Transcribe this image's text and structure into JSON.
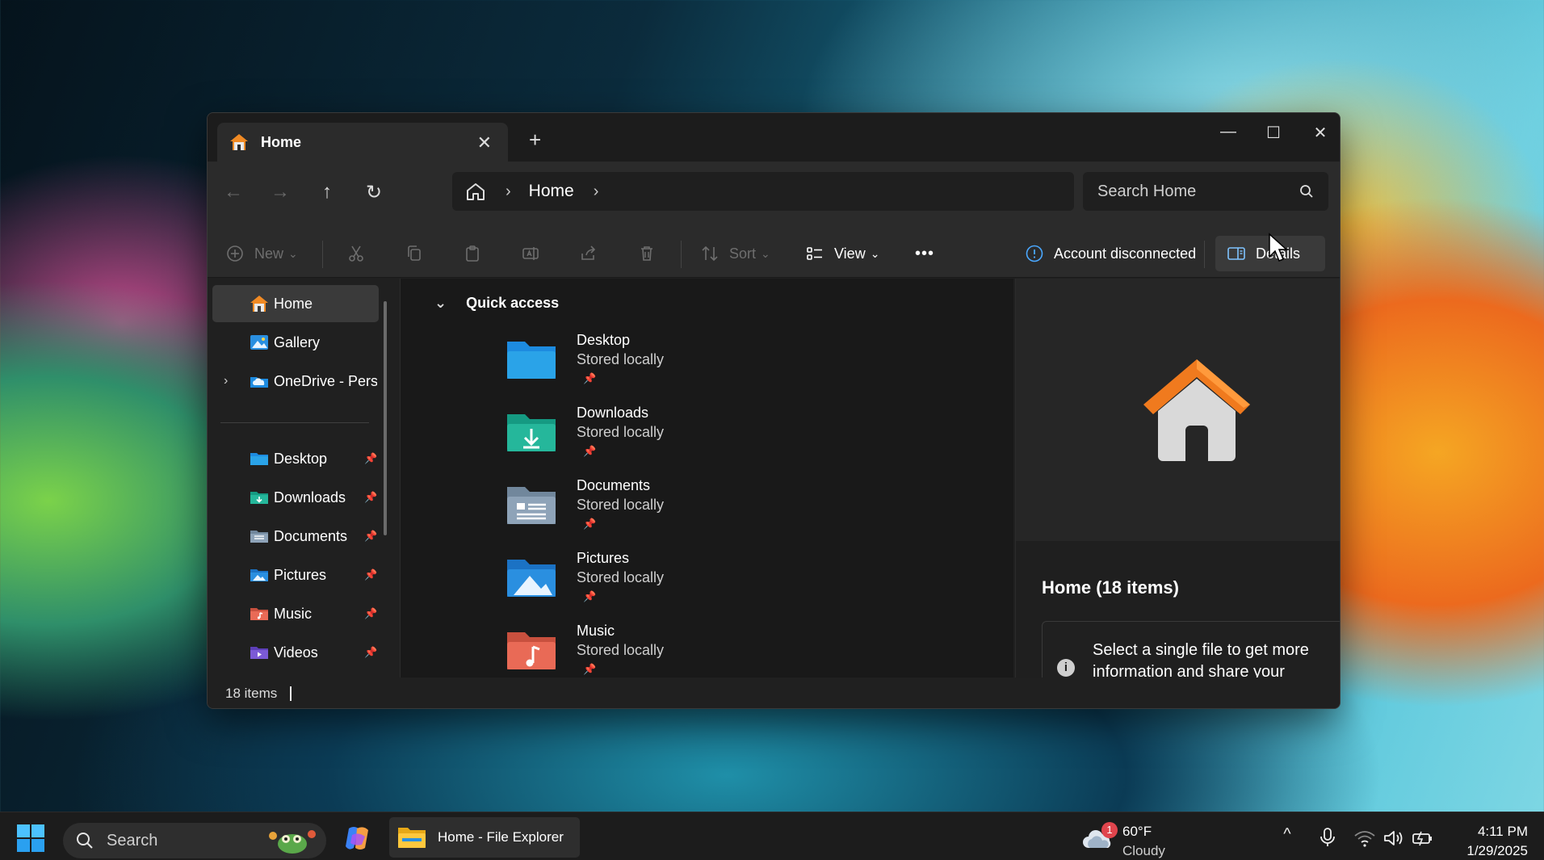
{
  "window": {
    "tab_title": "Home",
    "tab_close": "✕",
    "new_tab": "+",
    "minimize": "—",
    "maximize": "☐",
    "close": "✕"
  },
  "navbar": {
    "back": "←",
    "forward": "→",
    "up": "↑",
    "refresh": "↻",
    "breadcrumb": [
      "Home"
    ],
    "chevron": "›",
    "search_placeholder": "Search Home"
  },
  "toolbar": {
    "new_label": "New",
    "sort_label": "Sort",
    "view_label": "View",
    "more_label": "•••",
    "account_status": "Account disconnected",
    "details_label": "Details",
    "dropdown_caret": "⌄"
  },
  "sidebar": {
    "items": [
      {
        "label": "Home",
        "icon": "home-icon",
        "active": true
      },
      {
        "label": "Gallery",
        "icon": "gallery-icon"
      },
      {
        "label": "OneDrive - Personal",
        "icon": "onedrive-icon",
        "expandable": true
      }
    ],
    "pinned": [
      {
        "label": "Desktop",
        "icon": "desktop-folder-icon",
        "color": "#2aa3e8"
      },
      {
        "label": "Downloads",
        "icon": "downloads-folder-icon",
        "color": "#25b79b"
      },
      {
        "label": "Documents",
        "icon": "documents-folder-icon",
        "color": "#8ea3b8"
      },
      {
        "label": "Pictures",
        "icon": "pictures-folder-icon",
        "color": "#2a8fe0"
      },
      {
        "label": "Music",
        "icon": "music-folder-icon",
        "color": "#e96a56"
      },
      {
        "label": "Videos",
        "icon": "videos-folder-icon",
        "color": "#7b5ad6"
      }
    ],
    "pin_glyph": "📌",
    "expand_glyph": "›"
  },
  "content": {
    "section_title": "Quick access",
    "collapse_glyph": "⌄",
    "folders": [
      {
        "name": "Desktop",
        "status": "Stored locally",
        "icon": "desktop-folder-icon",
        "color": "#2aa3e8"
      },
      {
        "name": "Downloads",
        "status": "Stored locally",
        "icon": "downloads-folder-icon",
        "color": "#25b79b"
      },
      {
        "name": "Documents",
        "status": "Stored locally",
        "icon": "documents-folder-icon",
        "color": "#8ea3b8"
      },
      {
        "name": "Pictures",
        "status": "Stored locally",
        "icon": "pictures-folder-icon",
        "color": "#2a8fe0"
      },
      {
        "name": "Music",
        "status": "Stored locally",
        "icon": "music-folder-icon",
        "color": "#e96a56"
      }
    ]
  },
  "details_pane": {
    "title": "Home (18 items)",
    "message": "Select a single file to get more information and share your",
    "info_glyph": "i"
  },
  "statusbar": {
    "item_count": "18 items"
  },
  "taskbar": {
    "search_label": "Search",
    "app_label": "Home - File Explorer",
    "weather_temp": "60°F",
    "weather_condition": "Cloudy",
    "weather_badge": "1",
    "time": "4:11 PM",
    "date": "1/29/2025",
    "tray_chevron": "^",
    "accent": "#0078d4"
  }
}
